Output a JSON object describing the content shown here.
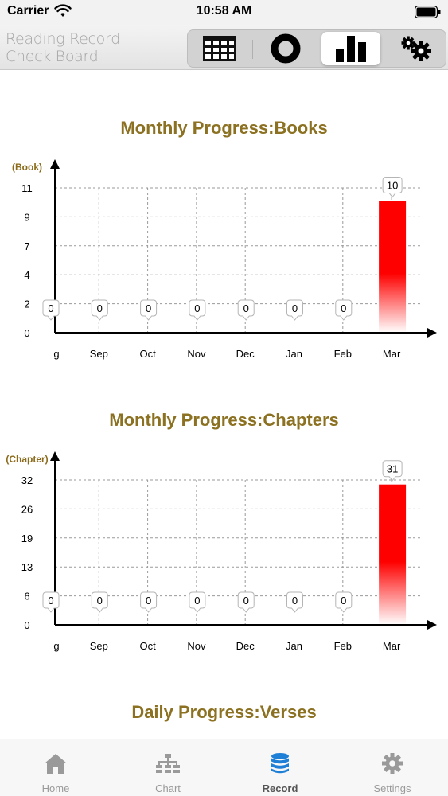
{
  "status_bar": {
    "carrier": "Carrier",
    "time": "10:58 AM"
  },
  "header": {
    "title_line1": "Reading Record",
    "title_line2": "Check Board",
    "segments": [
      {
        "icon": "calendar-grid-icon",
        "active": false
      },
      {
        "icon": "donut-ring-icon",
        "active": false
      },
      {
        "icon": "bar-chart-icon",
        "active": true
      },
      {
        "icon": "gears-icon",
        "active": false
      }
    ]
  },
  "colors": {
    "title": "#8b7121",
    "bar": "#ff0000",
    "unit_label": "#8b6a1a"
  },
  "chart_data": [
    {
      "type": "bar",
      "title": "Monthly Progress:Books",
      "ylabel": "(Book)",
      "categories": [
        "g",
        "Sep",
        "Oct",
        "Nov",
        "Dec",
        "Jan",
        "Feb",
        "Mar"
      ],
      "values": [
        0,
        0,
        0,
        0,
        0,
        0,
        0,
        10
      ],
      "yticks": [
        "0",
        "2",
        "4",
        "7",
        "9",
        "11"
      ],
      "ylim": [
        0,
        11
      ],
      "grid": true
    },
    {
      "type": "bar",
      "title": "Monthly Progress:Chapters",
      "ylabel": "(Chapter)",
      "categories": [
        "g",
        "Sep",
        "Oct",
        "Nov",
        "Dec",
        "Jan",
        "Feb",
        "Mar"
      ],
      "values": [
        0,
        0,
        0,
        0,
        0,
        0,
        0,
        31
      ],
      "yticks": [
        "0",
        "6",
        "13",
        "19",
        "26",
        "32"
      ],
      "ylim": [
        0,
        32
      ],
      "grid": true
    }
  ],
  "daily_title": "Daily Progress:Verses",
  "tabs": [
    {
      "label": "Home",
      "icon": "home-icon",
      "active": false
    },
    {
      "label": "Chart",
      "icon": "org-chart-icon",
      "active": false
    },
    {
      "label": "Record",
      "icon": "database-icon",
      "active": true
    },
    {
      "label": "Settings",
      "icon": "gear-icon",
      "active": false
    }
  ]
}
